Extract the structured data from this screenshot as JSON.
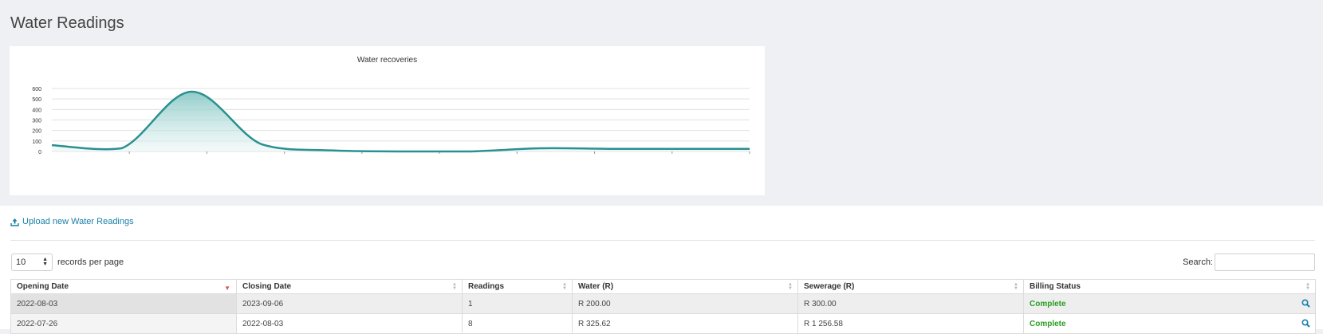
{
  "page": {
    "title": "Water Readings"
  },
  "chart_data": {
    "type": "area",
    "title": "Water recoveries",
    "xlabel": "",
    "ylabel": "",
    "ylim": [
      0,
      600
    ],
    "y_ticks": [
      0,
      100,
      200,
      300,
      400,
      500,
      600
    ],
    "grid": true,
    "legend": "none",
    "series": [
      {
        "values": [
          60,
          30,
          570,
          70,
          10,
          0,
          0,
          30,
          25,
          25,
          25
        ]
      }
    ],
    "colors": {
      "line": "#2a9190",
      "fill_top": "#7cc3c0",
      "fill_bottom": "#e8f5f4"
    }
  },
  "upload": {
    "label": "Upload new Water Readings",
    "icon": "upload-icon"
  },
  "length": {
    "value": "10",
    "suffix": "records per page"
  },
  "search": {
    "label": "Search:",
    "value": ""
  },
  "table": {
    "columns": [
      "Opening Date",
      "Closing Date",
      "Readings",
      "Water (R)",
      "Sewerage (R)",
      "Billing Status"
    ],
    "rows": [
      {
        "opening": "2022-08-03",
        "closing": "2023-09-06",
        "readings": "1",
        "water": "R 200.00",
        "sewerage": "R 300.00",
        "status": "Complete"
      },
      {
        "opening": "2022-07-26",
        "closing": "2022-08-03",
        "readings": "8",
        "water": "R 325.62",
        "sewerage": "R 1 256.58",
        "status": "Complete"
      }
    ]
  }
}
